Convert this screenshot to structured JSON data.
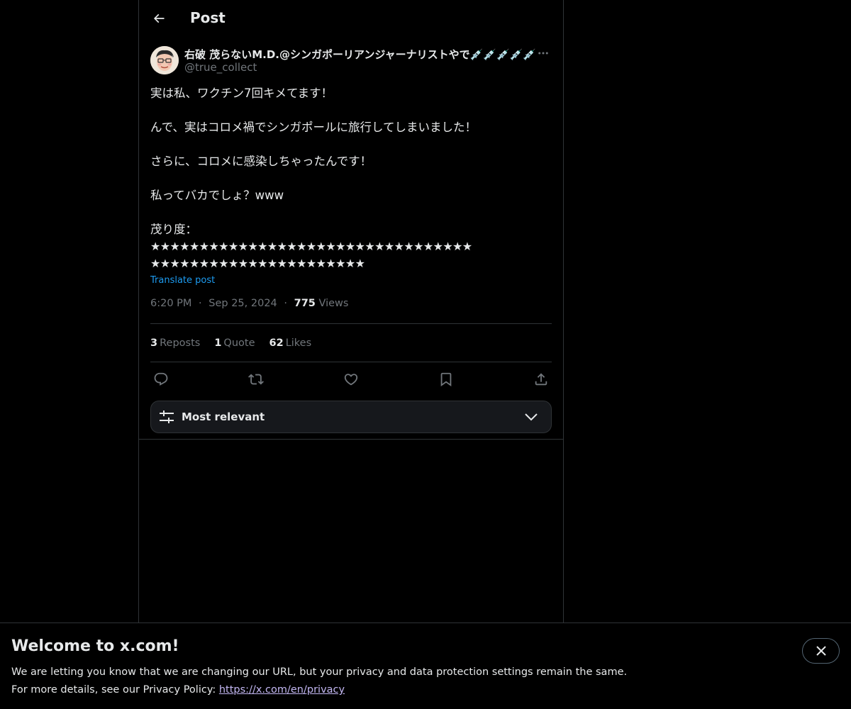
{
  "header": {
    "title": "Post"
  },
  "post": {
    "author_name": "右破 茂らないM.D.@シンガポーリアンジャーナリストやで💉💉💉💉💉",
    "author_handle": "@true_collect",
    "lines": [
      "実は私、ワクチン7回キメてます！",
      "",
      "んで、実はコロメ禍でシンガポールに旅行してしまいました！",
      "",
      "さらに、コロメに感染しちゃったんです！",
      "",
      "私ってバカでしょ？www",
      "",
      "茂り度："
    ],
    "stars_line1": "★★★★★★★★★★★★★★★★★★★★★★★★★★★★★★★★★",
    "stars_line2": "★★★★★★★★★★★★★★★★★★★★★★",
    "translate_label": "Translate post",
    "time": "6:20 PM",
    "date": "Sep 25, 2024",
    "views_count": "775",
    "views_label": "Views",
    "separator": "·"
  },
  "stats": {
    "reposts_count": "3",
    "reposts_label": "Reposts",
    "quote_count": "1",
    "quote_label": "Quote",
    "likes_count": "62",
    "likes_label": "Likes"
  },
  "actions": {
    "icons": [
      "reply-icon",
      "repost-icon",
      "like-icon",
      "bookmark-icon",
      "share-icon"
    ]
  },
  "sort": {
    "label": "Most relevant"
  },
  "banner": {
    "title": "Welcome to x.com!",
    "line1": "We are letting you know that we are changing our URL, but your privacy and data protection settings remain the same.",
    "line2_prefix": "For more details, see our Privacy Policy: ",
    "link": "https://x.com/en/privacy"
  },
  "colors": {
    "background": "#000000",
    "text": "#e7e9ea",
    "muted": "#71767b",
    "accent": "#1d9bf0",
    "border": "#2f3336",
    "link_visited": "#c3b7f2"
  }
}
